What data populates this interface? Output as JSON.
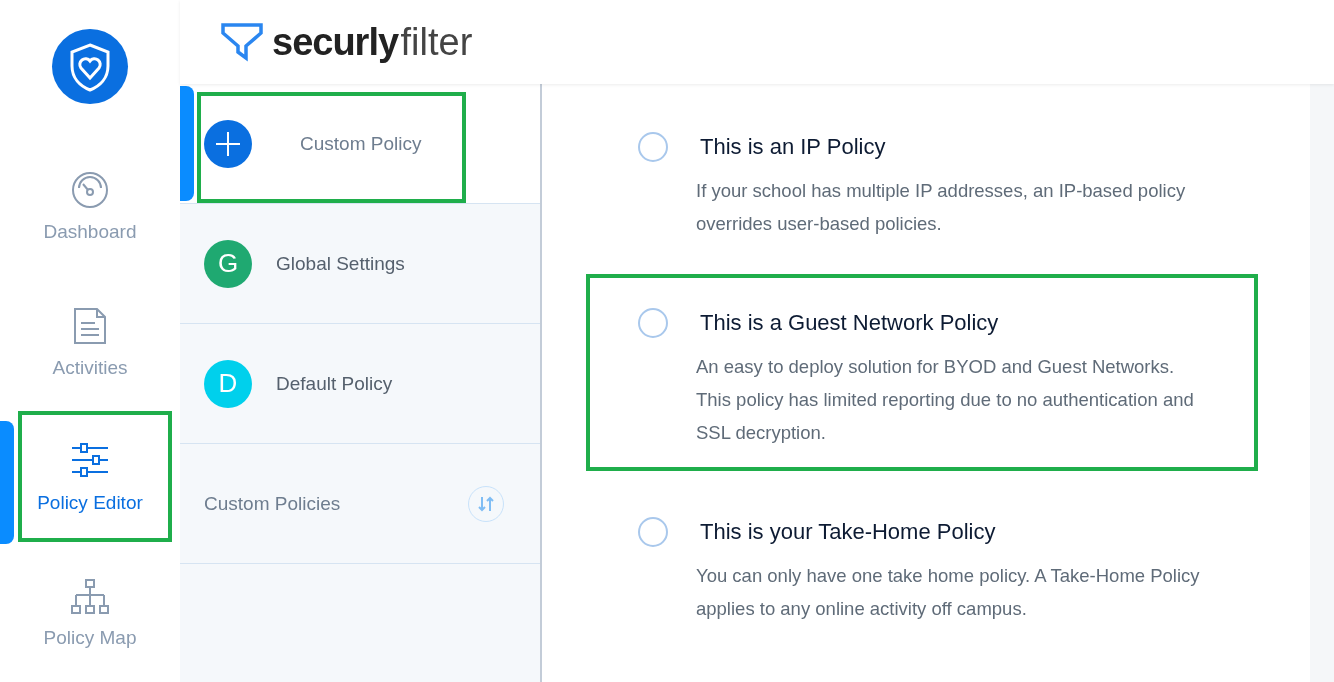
{
  "logo": {
    "brand": "securly",
    "product": "filter"
  },
  "nav": [
    {
      "label": "Dashboard",
      "selected": false,
      "highlighted": false
    },
    {
      "label": "Activities",
      "selected": false,
      "highlighted": false
    },
    {
      "label": "Policy Editor",
      "selected": true,
      "highlighted": true
    },
    {
      "label": "Policy Map",
      "selected": false,
      "highlighted": false
    }
  ],
  "policy_list": [
    {
      "kind": "add",
      "label": "Custom Policy",
      "selected": true,
      "highlighted": true,
      "color": "#0a6fe0"
    },
    {
      "kind": "letter",
      "badge": "G",
      "label": "Global Settings",
      "selected": false,
      "highlighted": false,
      "color": "#1fa971"
    },
    {
      "kind": "letter",
      "badge": "D",
      "label": "Default Policy",
      "selected": false,
      "highlighted": false,
      "color": "#00d0ec"
    }
  ],
  "section": {
    "label": "Custom Policies"
  },
  "options": [
    {
      "title": "This is an IP Policy",
      "description": "If your school has multiple IP addresses, an IP-based policy overrides user-based policies.",
      "selected": false,
      "highlighted": false
    },
    {
      "title": "This is a Guest Network Policy",
      "description": "An easy to deploy solution for BYOD and Guest Networks. This policy has limited reporting due to no authentication and SSL decryption.",
      "selected": false,
      "highlighted": true
    },
    {
      "title": "This is your Take-Home Policy",
      "description": "You can only have one take home policy. A Take-Home Policy applies to any online activity off campus.",
      "selected": false,
      "highlighted": false
    }
  ]
}
